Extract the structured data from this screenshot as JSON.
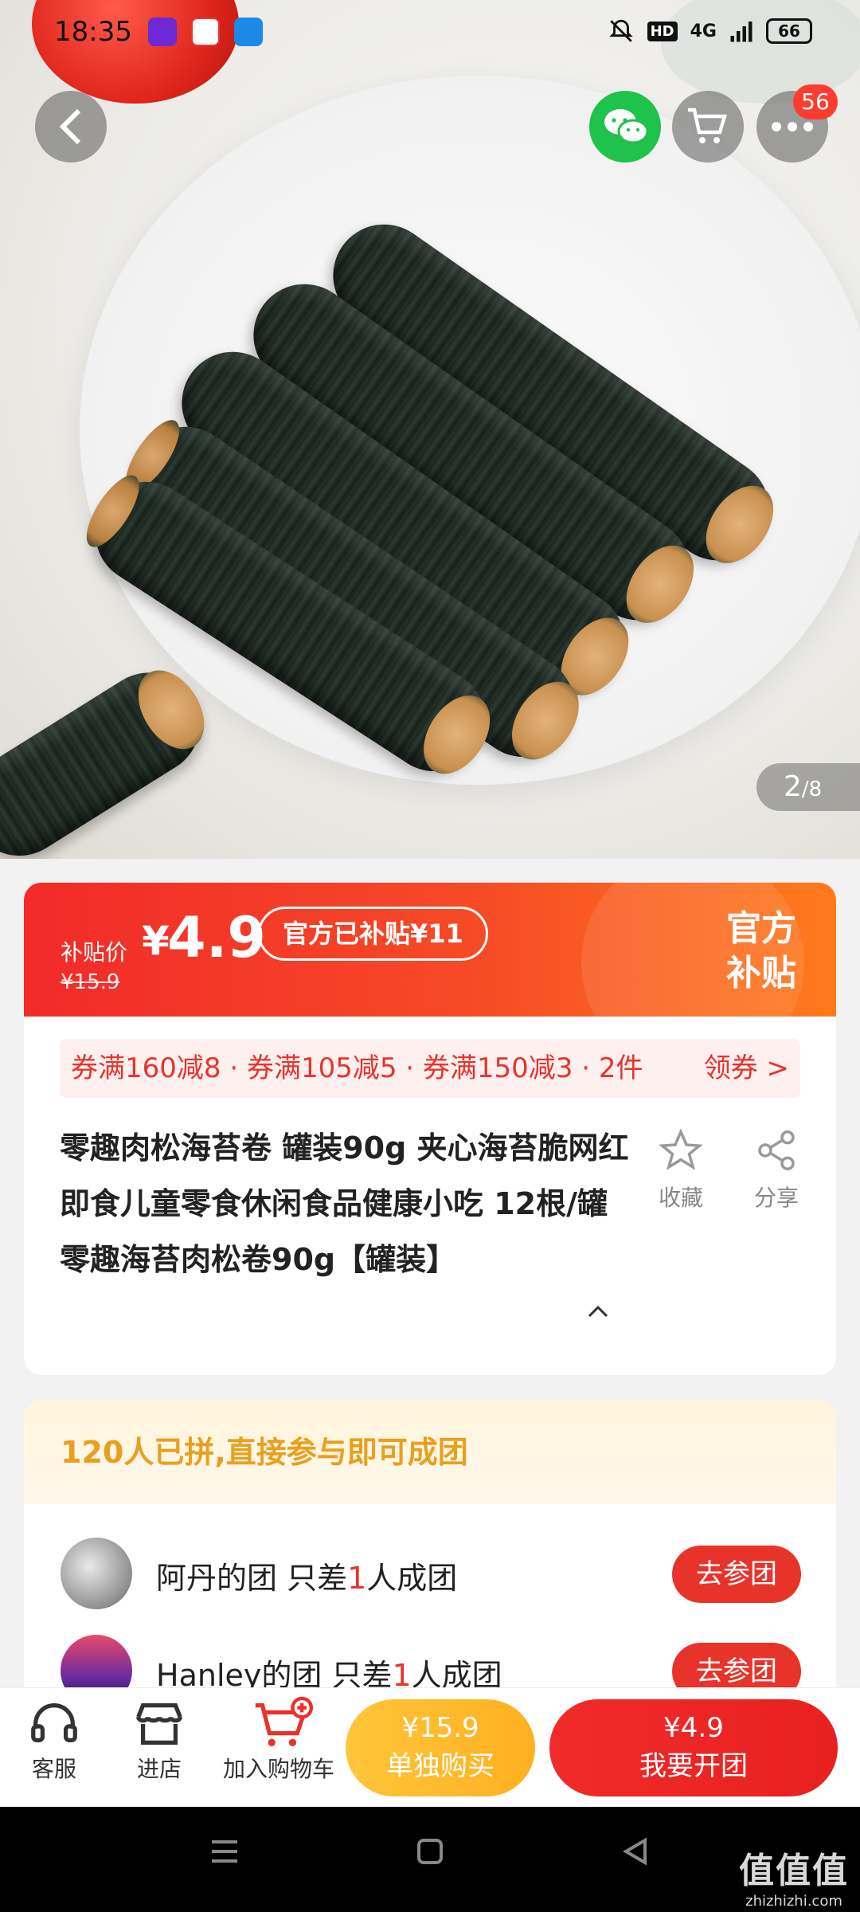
{
  "status_bar": {
    "time": "18:35",
    "network": "4G",
    "hd": "HD",
    "battery": "66"
  },
  "header": {
    "cart_badge": "56",
    "image_index": "2",
    "image_total": "/8"
  },
  "price": {
    "subsidy_label": "补贴价",
    "currency": "¥",
    "price": "4.9",
    "original_price": "¥15.9",
    "subsidy_pill": "官方已补贴¥11",
    "official_line1": "官方",
    "official_line2": "补贴"
  },
  "coupons": {
    "text": "券满160减8 · 券满105减5 · 券满150减3 · 2件",
    "action": "领券 >"
  },
  "product": {
    "title": "零趣肉松海苔卷 罐装90g 夹心海苔脆网红即食儿童零食休闲食品健康小吃 12根/罐 零趣海苔肉松卷90g【罐装】",
    "favorite_label": "收藏",
    "share_label": "分享"
  },
  "group_buy": {
    "header": "120人已拼,直接参与即可成团",
    "rows": [
      {
        "name": "阿丹的团 只差",
        "count": "1",
        "suffix": "人成团",
        "button": "去参团"
      },
      {
        "name": "Hanley的团 只差",
        "count": "1",
        "suffix": "人成团",
        "button": "去参团"
      }
    ]
  },
  "bottom_bar": {
    "service_label": "客服",
    "store_label": "进店",
    "add_cart_label": "加入购物车",
    "single_price": "¥15.9",
    "single_label": "单独购买",
    "group_price": "¥4.9",
    "group_label": "我要开团"
  },
  "watermark": {
    "brand": "值值值",
    "domain": "zhizhizhi.com"
  },
  "colors": {
    "accent_red": "#e8332a",
    "orange": "#ffb020",
    "wechat_green": "#1fc24a",
    "group_header_text": "#e8a020"
  }
}
